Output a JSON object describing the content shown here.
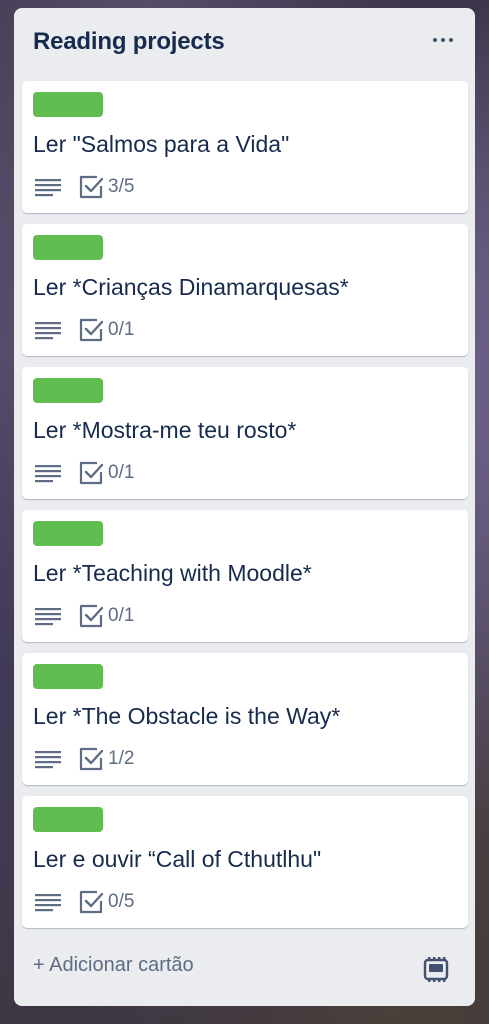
{
  "list": {
    "title": "Reading projects",
    "menu_icon": "more-horizontal-icon",
    "add_card_label": "+ Adicionar cartão",
    "template_icon": "card-template-icon"
  },
  "colors": {
    "label_green": "#61bd4f",
    "list_bg": "#ebecf0",
    "title_text": "#172b4d",
    "meta_text": "#5e6c84"
  },
  "cards": [
    {
      "title": "Ler \"Salmos para a Vida\"",
      "checklist": "3/5",
      "checklist_done": 3,
      "checklist_total": 5
    },
    {
      "title": "Ler *Crianças Dinamarquesas*",
      "checklist": "0/1",
      "checklist_done": 0,
      "checklist_total": 1
    },
    {
      "title": "Ler *Mostra-me teu rosto*",
      "checklist": "0/1",
      "checklist_done": 0,
      "checklist_total": 1
    },
    {
      "title": "Ler *Teaching with Moodle*",
      "checklist": "0/1",
      "checklist_done": 0,
      "checklist_total": 1
    },
    {
      "title": "Ler *The Obstacle is the Way*",
      "checklist": "1/2",
      "checklist_done": 1,
      "checklist_total": 2
    },
    {
      "title": "Ler e ouvir “Call of Cthutlhu\"",
      "checklist": "0/5",
      "checklist_done": 0,
      "checklist_total": 5
    }
  ]
}
